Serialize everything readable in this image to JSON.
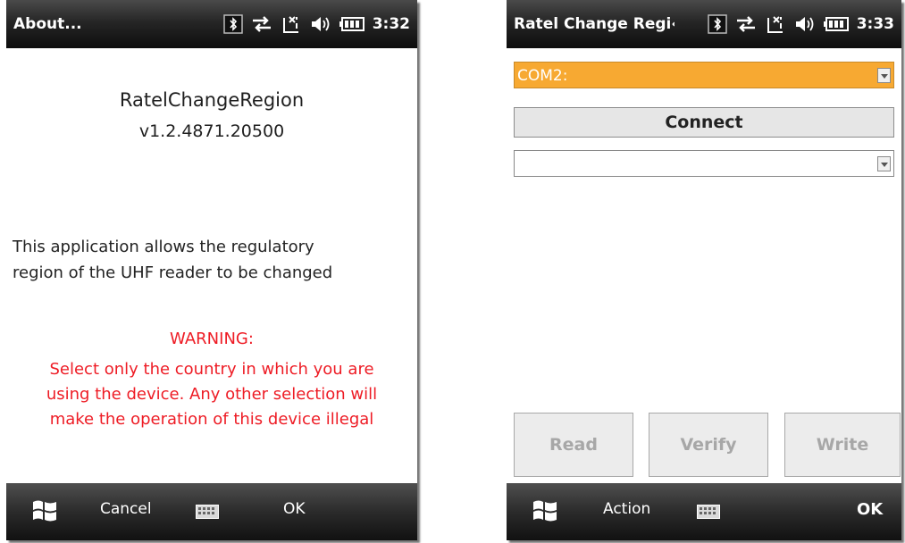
{
  "left_screen": {
    "title": "About...",
    "clock": "3:32",
    "app_name": "RatelChangeRegion",
    "version": "v1.2.4871.20500",
    "description_lines": [
      "This application allows the regulatory",
      "region of the UHF reader to be changed"
    ],
    "warning_title": "WARNING:",
    "warning_lines": [
      "Select only the country in which you are",
      "using the device. Any other selection will",
      "make the operation of this device illegal"
    ],
    "softkeys": {
      "left": "Cancel",
      "right": "OK"
    }
  },
  "right_screen": {
    "title": "Ratel Change Regi‹",
    "clock": "3:33",
    "port_select": {
      "value": "COM2:",
      "highlight_color": "#f7a932"
    },
    "connect_label": "Connect",
    "region_select": {
      "value": ""
    },
    "actions": [
      "Read",
      "Verify",
      "Write"
    ],
    "softkeys": {
      "left": "Action",
      "right": "OK"
    }
  },
  "status_icons": [
    "bluetooth-icon",
    "connectivity-icon",
    "signal-off-icon",
    "volume-icon",
    "battery-icon"
  ],
  "colors": {
    "warning": "#ee1c25",
    "title_bar": "#1a1a1a",
    "accent": "#f7a932"
  }
}
